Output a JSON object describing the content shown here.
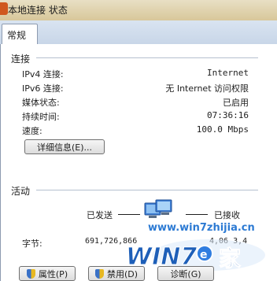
{
  "window": {
    "title": "本地连接 状态"
  },
  "tabs": [
    {
      "label": "常规"
    }
  ],
  "connection": {
    "group_title": "连接",
    "rows": [
      {
        "label": "IPv4 连接:",
        "value": "Internet"
      },
      {
        "label": "IPv6 连接:",
        "value": "无 Internet 访问权限"
      },
      {
        "label": "媒体状态:",
        "value": "已启用"
      },
      {
        "label": "持续时间:",
        "value": "07:36:16"
      },
      {
        "label": "速度:",
        "value": "100.0 Mbps"
      }
    ],
    "details_button": "详细信息(E)..."
  },
  "activity": {
    "group_title": "活动",
    "sent_label": "已发送",
    "received_label": "已接收",
    "bytes_label": "字节:",
    "bytes_sent": "691,726,866",
    "bytes_received": "4,06  3,4"
  },
  "buttons": {
    "properties": "属性(P)",
    "disable": "禁用(D)",
    "diagnose": "诊断(G)"
  },
  "watermark": {
    "url": "www.win7zhijia.cn",
    "logo_text": "WIN7",
    "logo_suffix": "家"
  },
  "colors": {
    "accent": "#1b6fd0",
    "title_bar": "#d8c79a",
    "tab_strip": "#c8d6e8",
    "group_line": "#b5c0cf"
  }
}
